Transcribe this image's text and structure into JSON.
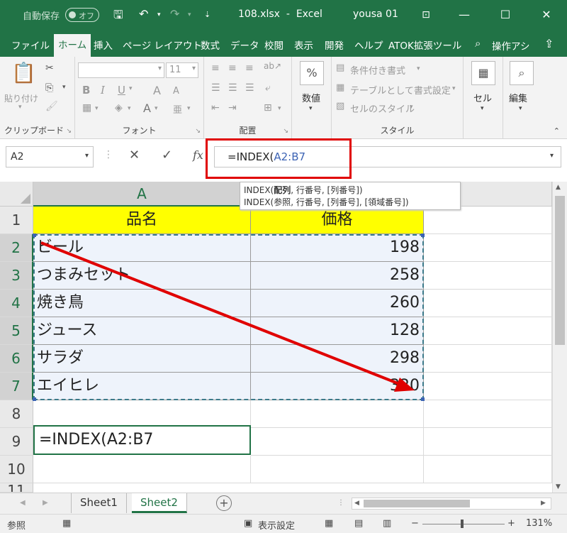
{
  "titlebar": {
    "autosave_label": "自動保存",
    "autosave_state": "オフ",
    "filename": "108.xlsx",
    "app_sep": "-",
    "app": "Excel",
    "user": "yousa 01"
  },
  "tabs": [
    "ファイル",
    "ホーム",
    "挿入",
    "ページ レイアウト",
    "数式",
    "データ",
    "校閲",
    "表示",
    "開発",
    "ヘルプ",
    "ATOK拡張ツール"
  ],
  "tell_me": "操作アシ",
  "ribbon": {
    "clipboard": {
      "paste": "貼り付け",
      "label": "クリップボード"
    },
    "font": {
      "size": "11",
      "bold": "B",
      "italic": "I",
      "underline": "U",
      "grow": "A",
      "shrink": "A",
      "label": "フォント"
    },
    "alignment": {
      "label": "配置"
    },
    "number": {
      "percent": "%",
      "label": "数値"
    },
    "styles": {
      "conditional": "条件付き書式",
      "table": "テーブルとして書式設定",
      "cell_styles": "セルのスタイル",
      "label": "スタイル"
    },
    "cells": {
      "label": "セル"
    },
    "editing": {
      "label": "編集"
    }
  },
  "formula_bar": {
    "name_box": "A2",
    "cancel": "✕",
    "enter": "✓",
    "fx": "fx",
    "formula_prefix": "=INDEX(",
    "formula_ref": "A2:B7"
  },
  "tooltip": {
    "line1_pre": "INDEX(",
    "line1_bold": "配列",
    "line1_post": ", 行番号, [列番号])",
    "line2": "INDEX(参照, 行番号, [列番号], [領域番号])"
  },
  "grid": {
    "column_a": "A",
    "rows": [
      "1",
      "2",
      "3",
      "4",
      "5",
      "6",
      "7",
      "8",
      "9",
      "10",
      "11"
    ],
    "header": [
      "品名",
      "価格"
    ],
    "data": [
      {
        "name": "ビール",
        "price": "198"
      },
      {
        "name": "つまみセット",
        "price": "258"
      },
      {
        "name": "焼き鳥",
        "price": "260"
      },
      {
        "name": "ジュース",
        "price": "128"
      },
      {
        "name": "サラダ",
        "price": "298"
      },
      {
        "name": "エイヒレ",
        "price": "320"
      }
    ],
    "active_prefix": "=INDEX(",
    "active_ref": "A2:B7"
  },
  "sheets": [
    "Sheet1",
    "Sheet2"
  ],
  "active_sheet": "Sheet2",
  "status": {
    "mode": "参照",
    "display_settings": "表示設定",
    "zoom": "131%"
  },
  "colors": {
    "excel_green": "#217346",
    "header_fill": "#ffff00",
    "highlight_red": "#e00000",
    "ref_blue": "#3c63b4"
  }
}
